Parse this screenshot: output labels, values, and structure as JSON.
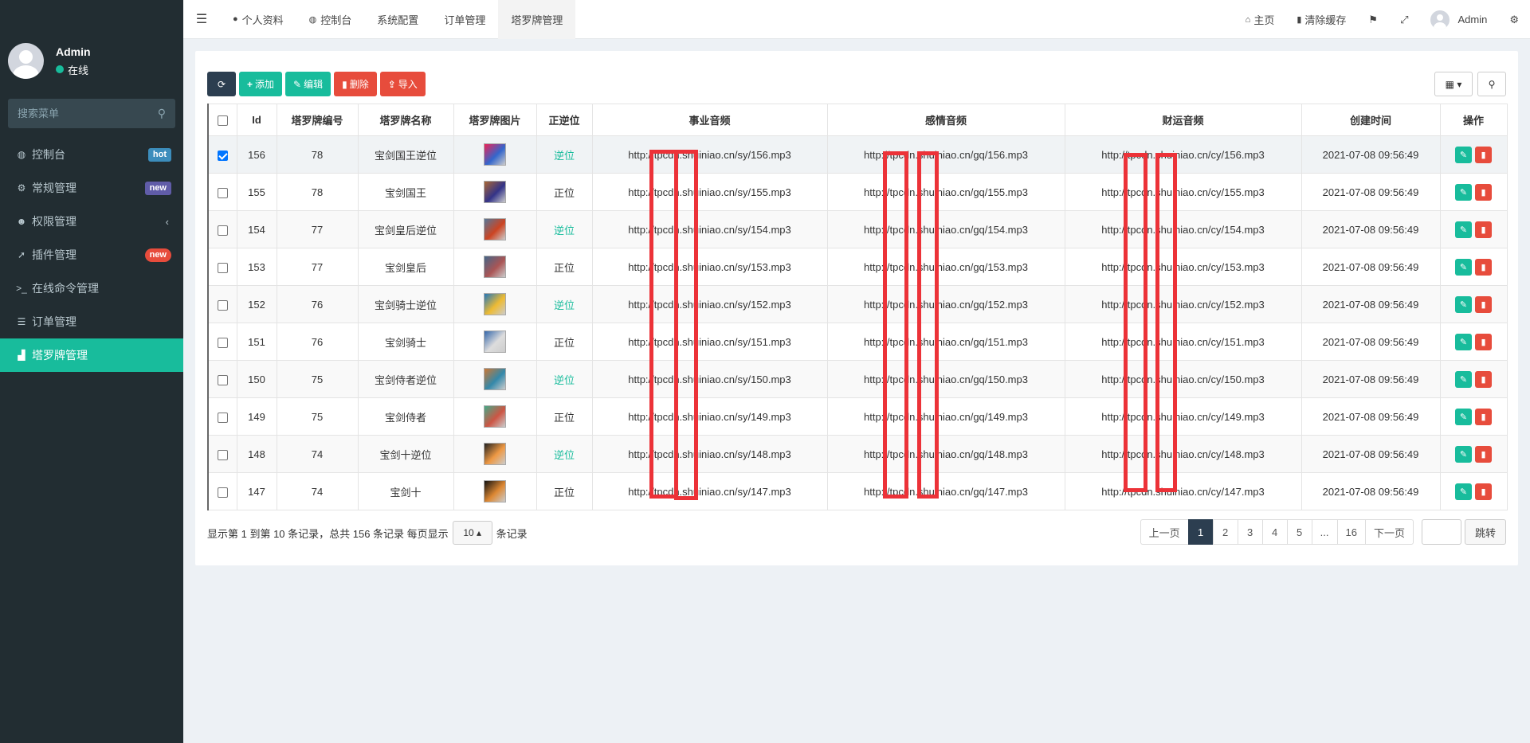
{
  "sidebar": {
    "user": {
      "name": "Admin",
      "status": "在线"
    },
    "search_placeholder": "搜索菜单",
    "items": [
      {
        "icon": "dashboard-icon",
        "glyph": "◍",
        "label": "控制台",
        "badge": "hot"
      },
      {
        "icon": "cogs-icon",
        "glyph": "⚙",
        "label": "常规管理",
        "badge": "new"
      },
      {
        "icon": "users-icon",
        "glyph": "☻",
        "label": "权限管理",
        "chevron": "‹"
      },
      {
        "icon": "rocket-icon",
        "glyph": "➚",
        "label": "插件管理",
        "badge": "new"
      },
      {
        "icon": "terminal-icon",
        "glyph": ">_",
        "label": "在线命令管理"
      },
      {
        "icon": "list-icon",
        "glyph": "☰",
        "label": "订单管理"
      },
      {
        "icon": "chart-icon",
        "glyph": "▟",
        "label": "塔罗牌管理"
      }
    ]
  },
  "topbar": {
    "tabs": [
      "个人资料",
      "控制台",
      "系统配置",
      "订单管理",
      "塔罗牌管理"
    ],
    "right": {
      "home": "主页",
      "clear_cache": "清除缓存",
      "user": "Admin"
    }
  },
  "toolbar": {
    "add": "添加",
    "edit": "编辑",
    "delete": "删除",
    "import": "导入"
  },
  "table": {
    "headers": [
      "Id",
      "塔罗牌编号",
      "塔罗牌名称",
      "塔罗牌图片",
      "正逆位",
      "事业音频",
      "感情音频",
      "财运音频",
      "创建时间",
      "操作"
    ],
    "rows": [
      {
        "id": "156",
        "num": "78",
        "name": "宝剑国王逆位",
        "pos": "逆位",
        "sy": "http://tpcdn.shuiniao.cn/sy/156.mp3",
        "gq": "http://tpcdn.shuiniao.cn/gq/156.mp3",
        "cy": "http://tpcdn.shuiniao.cn/cy/156.mp3",
        "time": "2021-07-08 09:56:49",
        "checked": true
      },
      {
        "id": "155",
        "num": "78",
        "name": "宝剑国王",
        "pos": "正位",
        "sy": "http://tpcdn.shuiniao.cn/sy/155.mp3",
        "gq": "http://tpcdn.shuiniao.cn/gq/155.mp3",
        "cy": "http://tpcdn.shuiniao.cn/cy/155.mp3",
        "time": "2021-07-08 09:56:49"
      },
      {
        "id": "154",
        "num": "77",
        "name": "宝剑皇后逆位",
        "pos": "逆位",
        "sy": "http://tpcdn.shuiniao.cn/sy/154.mp3",
        "gq": "http://tpcdn.shuiniao.cn/gq/154.mp3",
        "cy": "http://tpcdn.shuiniao.cn/cy/154.mp3",
        "time": "2021-07-08 09:56:49"
      },
      {
        "id": "153",
        "num": "77",
        "name": "宝剑皇后",
        "pos": "正位",
        "sy": "http://tpcdn.shuiniao.cn/sy/153.mp3",
        "gq": "http://tpcdn.shuiniao.cn/gq/153.mp3",
        "cy": "http://tpcdn.shuiniao.cn/cy/153.mp3",
        "time": "2021-07-08 09:56:49"
      },
      {
        "id": "152",
        "num": "76",
        "name": "宝剑骑士逆位",
        "pos": "逆位",
        "sy": "http://tpcdn.shuiniao.cn/sy/152.mp3",
        "gq": "http://tpcdn.shuiniao.cn/gq/152.mp3",
        "cy": "http://tpcdn.shuiniao.cn/cy/152.mp3",
        "time": "2021-07-08 09:56:49"
      },
      {
        "id": "151",
        "num": "76",
        "name": "宝剑骑士",
        "pos": "正位",
        "sy": "http://tpcdn.shuiniao.cn/sy/151.mp3",
        "gq": "http://tpcdn.shuiniao.cn/gq/151.mp3",
        "cy": "http://tpcdn.shuiniao.cn/cy/151.mp3",
        "time": "2021-07-08 09:56:49"
      },
      {
        "id": "150",
        "num": "75",
        "name": "宝剑侍者逆位",
        "pos": "逆位",
        "sy": "http://tpcdn.shuiniao.cn/sy/150.mp3",
        "gq": "http://tpcdn.shuiniao.cn/gq/150.mp3",
        "cy": "http://tpcdn.shuiniao.cn/cy/150.mp3",
        "time": "2021-07-08 09:56:49"
      },
      {
        "id": "149",
        "num": "75",
        "name": "宝剑侍者",
        "pos": "正位",
        "sy": "http://tpcdn.shuiniao.cn/sy/149.mp3",
        "gq": "http://tpcdn.shuiniao.cn/gq/149.mp3",
        "cy": "http://tpcdn.shuiniao.cn/cy/149.mp3",
        "time": "2021-07-08 09:56:49"
      },
      {
        "id": "148",
        "num": "74",
        "name": "宝剑十逆位",
        "pos": "逆位",
        "sy": "http://tpcdn.shuiniao.cn/sy/148.mp3",
        "gq": "http://tpcdn.shuiniao.cn/gq/148.mp3",
        "cy": "http://tpcdn.shuiniao.cn/cy/148.mp3",
        "time": "2021-07-08 09:56:49"
      },
      {
        "id": "147",
        "num": "74",
        "name": "宝剑十",
        "pos": "正位",
        "sy": "http://tpcdn.shuiniao.cn/sy/147.mp3",
        "gq": "http://tpcdn.shuiniao.cn/gq/147.mp3",
        "cy": "http://tpcdn.shuiniao.cn/cy/147.mp3",
        "time": "2021-07-08 09:56:49"
      }
    ]
  },
  "footer": {
    "summary_before": "显示第 1 到第 10 条记录，总共 156 条记录 每页显示",
    "page_size": "10",
    "summary_after": "条记录"
  },
  "pagination": {
    "prev": "上一页",
    "pages": [
      "1",
      "2",
      "3",
      "4",
      "5",
      "...",
      "16"
    ],
    "current": "1",
    "next": "下一页",
    "jump": "跳转"
  },
  "colors": {
    "accent": "#18bc9c",
    "danger": "#e74c3c",
    "dark": "#2c3e50",
    "sidebar": "#222d32"
  }
}
